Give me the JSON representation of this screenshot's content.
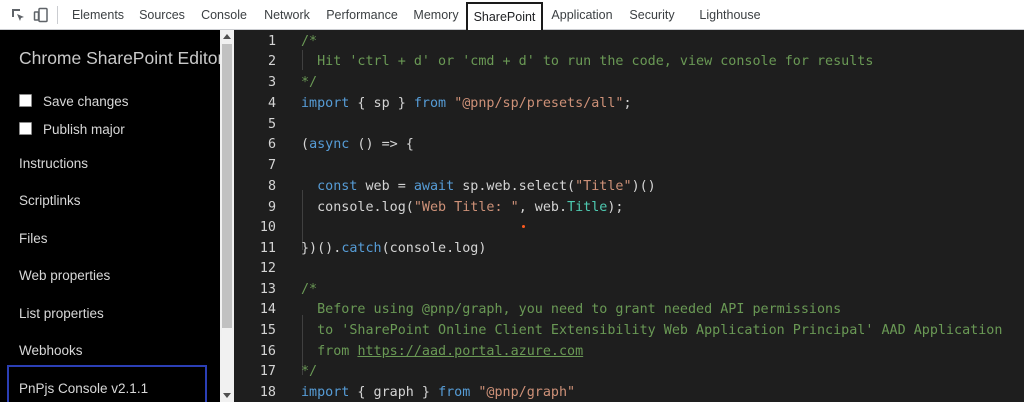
{
  "tabs": [
    {
      "label": "Elements",
      "active": false
    },
    {
      "label": "Sources",
      "active": false
    },
    {
      "label": "Console",
      "active": false
    },
    {
      "label": "Network",
      "active": false
    },
    {
      "label": "Performance",
      "active": false
    },
    {
      "label": "Memory",
      "active": false
    },
    {
      "label": "SharePoint",
      "active": true
    },
    {
      "label": "Application",
      "active": false
    },
    {
      "label": "Security",
      "active": false
    },
    {
      "label": "Lighthouse",
      "active": false
    }
  ],
  "toolbar_icons": [
    "inspect-element-icon",
    "device-toggle-icon"
  ],
  "sidebar": {
    "title": "Chrome SharePoint Editor",
    "options": [
      {
        "label": "Save changes",
        "checked": false
      },
      {
        "label": "Publish major",
        "checked": false
      }
    ],
    "items": [
      "Instructions",
      "Scriptlinks",
      "Files",
      "Web properties",
      "List properties",
      "Webhooks"
    ],
    "console_label": "PnPjs Console v2.1.1"
  },
  "editor": {
    "lines": [
      {
        "n": "1",
        "tokens": [
          {
            "t": "/*",
            "c": "com"
          }
        ]
      },
      {
        "n": "2",
        "tokens": [
          {
            "t": "  Hit 'ctrl + d' or 'cmd + d' to run the code, view console for results",
            "c": "com"
          }
        ]
      },
      {
        "n": "3",
        "tokens": [
          {
            "t": "*/",
            "c": "com"
          }
        ]
      },
      {
        "n": "4",
        "tokens": [
          {
            "t": "import",
            "c": "kw"
          },
          {
            "t": " { sp } ",
            "c": "id"
          },
          {
            "t": "from",
            "c": "kw"
          },
          {
            "t": " ",
            "c": "id"
          },
          {
            "t": "\"@pnp/sp/presets/all\"",
            "c": "str"
          },
          {
            "t": ";",
            "c": "id"
          }
        ]
      },
      {
        "n": "5",
        "tokens": []
      },
      {
        "n": "6",
        "tokens": [
          {
            "t": "(",
            "c": "id"
          },
          {
            "t": "async",
            "c": "kw"
          },
          {
            "t": " () => {",
            "c": "id"
          }
        ]
      },
      {
        "n": "7",
        "tokens": []
      },
      {
        "n": "8",
        "tokens": [
          {
            "t": "  ",
            "c": "id"
          },
          {
            "t": "const",
            "c": "kw"
          },
          {
            "t": " web = ",
            "c": "id"
          },
          {
            "t": "await",
            "c": "kw"
          },
          {
            "t": " sp.web.select(",
            "c": "id"
          },
          {
            "t": "\"Title\"",
            "c": "str"
          },
          {
            "t": ")()",
            "c": "id"
          }
        ]
      },
      {
        "n": "9",
        "tokens": [
          {
            "t": "  console.log(",
            "c": "id"
          },
          {
            "t": "\"Web Title: \"",
            "c": "str"
          },
          {
            "t": ", web.",
            "c": "id"
          },
          {
            "t": "Title",
            "c": "prop"
          },
          {
            "t": ");",
            "c": "id"
          }
        ]
      },
      {
        "n": "10",
        "tokens": []
      },
      {
        "n": "11",
        "tokens": [
          {
            "t": "})().",
            "c": "id"
          },
          {
            "t": "catch",
            "c": "kw"
          },
          {
            "t": "(console.log)",
            "c": "id"
          }
        ]
      },
      {
        "n": "12",
        "tokens": []
      },
      {
        "n": "13",
        "tokens": [
          {
            "t": "/*",
            "c": "com"
          }
        ]
      },
      {
        "n": "14",
        "tokens": [
          {
            "t": "  Before using @pnp/graph, you need to grant needed API permissions",
            "c": "com"
          }
        ]
      },
      {
        "n": "15",
        "tokens": [
          {
            "t": "  to 'SharePoint Online Client Extensibility Web Application Principal' AAD Application",
            "c": "com"
          }
        ]
      },
      {
        "n": "16",
        "tokens": [
          {
            "t": "  from ",
            "c": "com"
          },
          {
            "t": "https://aad.portal.azure.com",
            "c": "link"
          }
        ]
      },
      {
        "n": "17",
        "tokens": [
          {
            "t": "*/",
            "c": "com"
          }
        ]
      },
      {
        "n": "18",
        "tokens": [
          {
            "t": "import",
            "c": "kw"
          },
          {
            "t": " { graph } ",
            "c": "id"
          },
          {
            "t": "from",
            "c": "kw"
          },
          {
            "t": " ",
            "c": "id"
          },
          {
            "t": "\"@pnp/graph\"",
            "c": "str"
          }
        ]
      }
    ]
  }
}
